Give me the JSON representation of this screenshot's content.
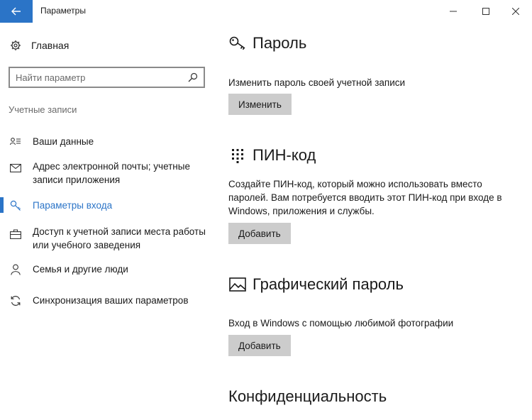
{
  "window": {
    "title": "Параметры",
    "back_icon": "arrow-left-icon",
    "accent_color": "#2b74c7"
  },
  "sidebar": {
    "home_label": "Главная",
    "search_placeholder": "Найти параметр",
    "section_label": "Учетные записи",
    "items": [
      {
        "label": "Ваши данные",
        "icon": "person-card-icon"
      },
      {
        "label": "Адрес электронной почты; учетные записи приложения",
        "icon": "mail-icon"
      },
      {
        "label": "Параметры входа",
        "icon": "key-icon",
        "active": true
      },
      {
        "label": "Доступ к учетной записи места работы или учебного заведения",
        "icon": "briefcase-icon"
      },
      {
        "label": "Семья и другие люди",
        "icon": "person-icon"
      },
      {
        "label": "Синхронизация ваших параметров",
        "icon": "sync-icon"
      }
    ]
  },
  "main": {
    "password": {
      "title": "Пароль",
      "description": "Изменить пароль своей учетной записи",
      "button": "Изменить"
    },
    "pin": {
      "title": "ПИН-код",
      "description": "Создайте ПИН-код, который можно использовать вместо паролей. Вам потребуется вводить этот ПИН-код при входе в Windows, приложения и службы.",
      "button": "Добавить"
    },
    "picture_password": {
      "title": "Графический пароль",
      "description": "Вход в Windows с помощью любимой фотографии",
      "button": "Добавить"
    },
    "privacy": {
      "title": "Конфиденциальность"
    }
  }
}
